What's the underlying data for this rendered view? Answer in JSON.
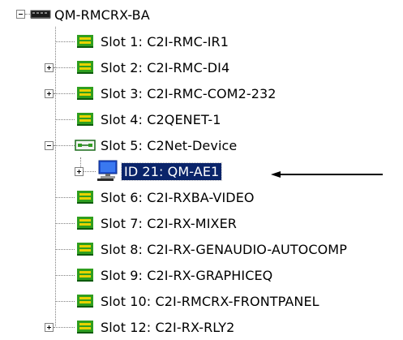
{
  "tree": {
    "root": {
      "label": "QM-RMCRX-BA",
      "icon": "device-icon",
      "expanded": true
    },
    "items": [
      {
        "label": "Slot 1: C2I-RMC-IR1",
        "icon": "card-icon",
        "expander": "none"
      },
      {
        "label": "Slot 2: C2I-RMC-DI4",
        "icon": "card-icon",
        "expander": "collapsed"
      },
      {
        "label": "Slot 3: C2I-RMC-COM2-232",
        "icon": "card-icon",
        "expander": "collapsed"
      },
      {
        "label": "Slot 4: C2QENET-1",
        "icon": "card-icon",
        "expander": "none"
      },
      {
        "label": "Slot 5: C2Net-Device",
        "icon": "network-card-icon",
        "expander": "expanded"
      },
      {
        "label": "ID 21: QM-AE1",
        "icon": "computer-icon",
        "expander": "collapsed",
        "selected": true,
        "child": true
      },
      {
        "label": "Slot 6: C2I-RXBA-VIDEO",
        "icon": "card-icon",
        "expander": "none"
      },
      {
        "label": "Slot 7: C2I-RX-MIXER",
        "icon": "card-icon",
        "expander": "none"
      },
      {
        "label": "Slot 8: C2I-RX-GENAUDIO-AUTOCOMP",
        "icon": "card-icon",
        "expander": "none"
      },
      {
        "label": "Slot 9: C2I-RX-GRAPHICEQ",
        "icon": "card-icon",
        "expander": "none"
      },
      {
        "label": "Slot 10: C2I-RMCRX-FRONTPANEL",
        "icon": "card-icon",
        "expander": "none"
      },
      {
        "label": "Slot 12: C2I-RX-RLY2",
        "icon": "card-icon",
        "expander": "collapsed"
      }
    ]
  },
  "colors": {
    "selection_bg": "#0a246a",
    "selection_text": "#ffffff",
    "card_green": "#2f9e1f",
    "card_yellow": "#e8d200",
    "tree_lines": "#808080"
  },
  "annotation": {
    "icon": "left-arrow-icon"
  }
}
